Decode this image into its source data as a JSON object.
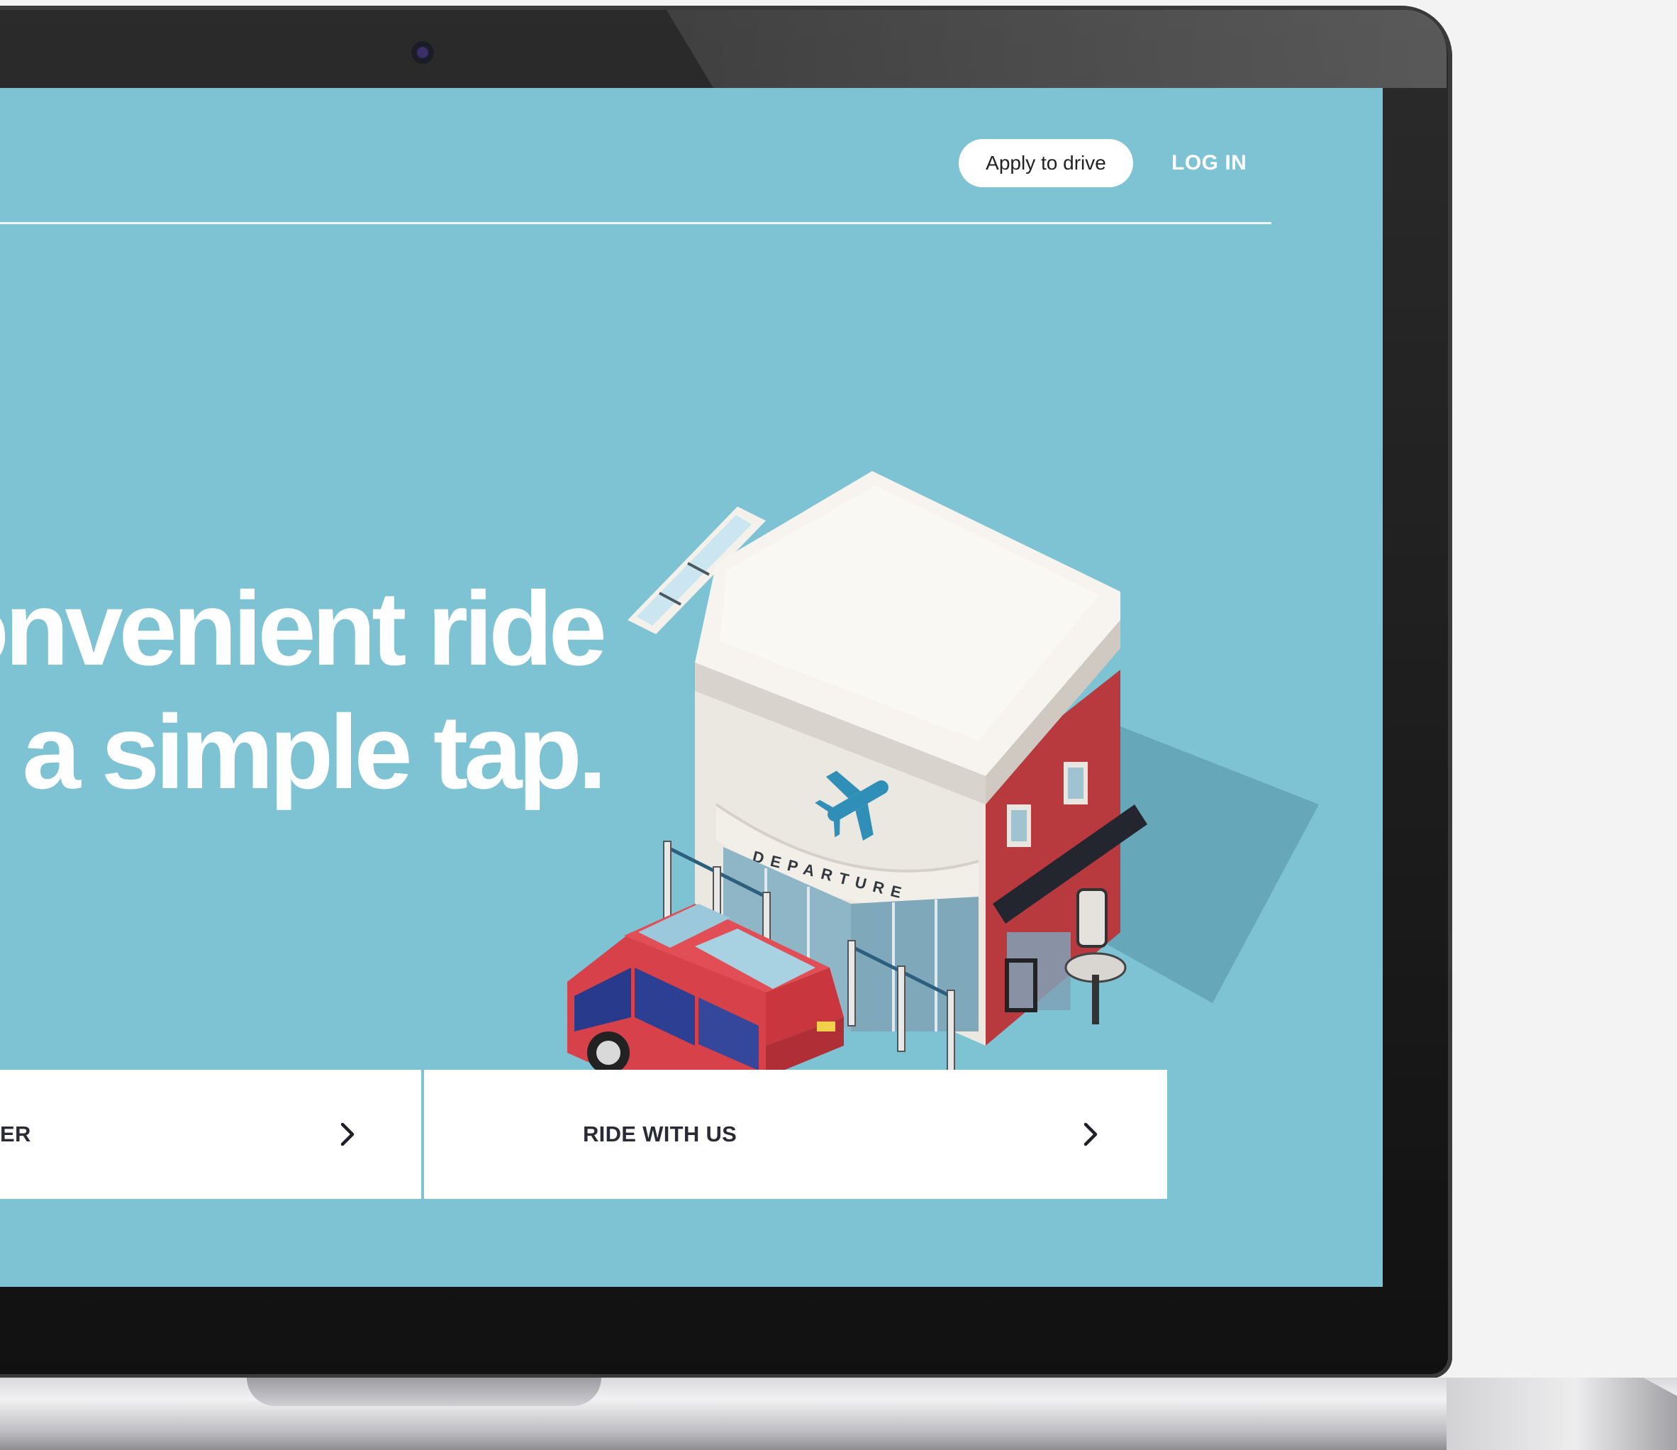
{
  "header": {
    "apply_label": "Apply to drive",
    "login_label": "LOG IN"
  },
  "hero": {
    "headline_line1": "onvenient ride",
    "headline_line2": "n a simple tap."
  },
  "illustration": {
    "building_sign": "DEPARTURE"
  },
  "cards": {
    "left_label": "ER",
    "right_label": "RIDE WITH US"
  },
  "colors": {
    "screen_background": "#7dc3d4",
    "card_background": "#ffffff",
    "car_body": "#d6414a",
    "building_brick": "#b83a3f"
  }
}
